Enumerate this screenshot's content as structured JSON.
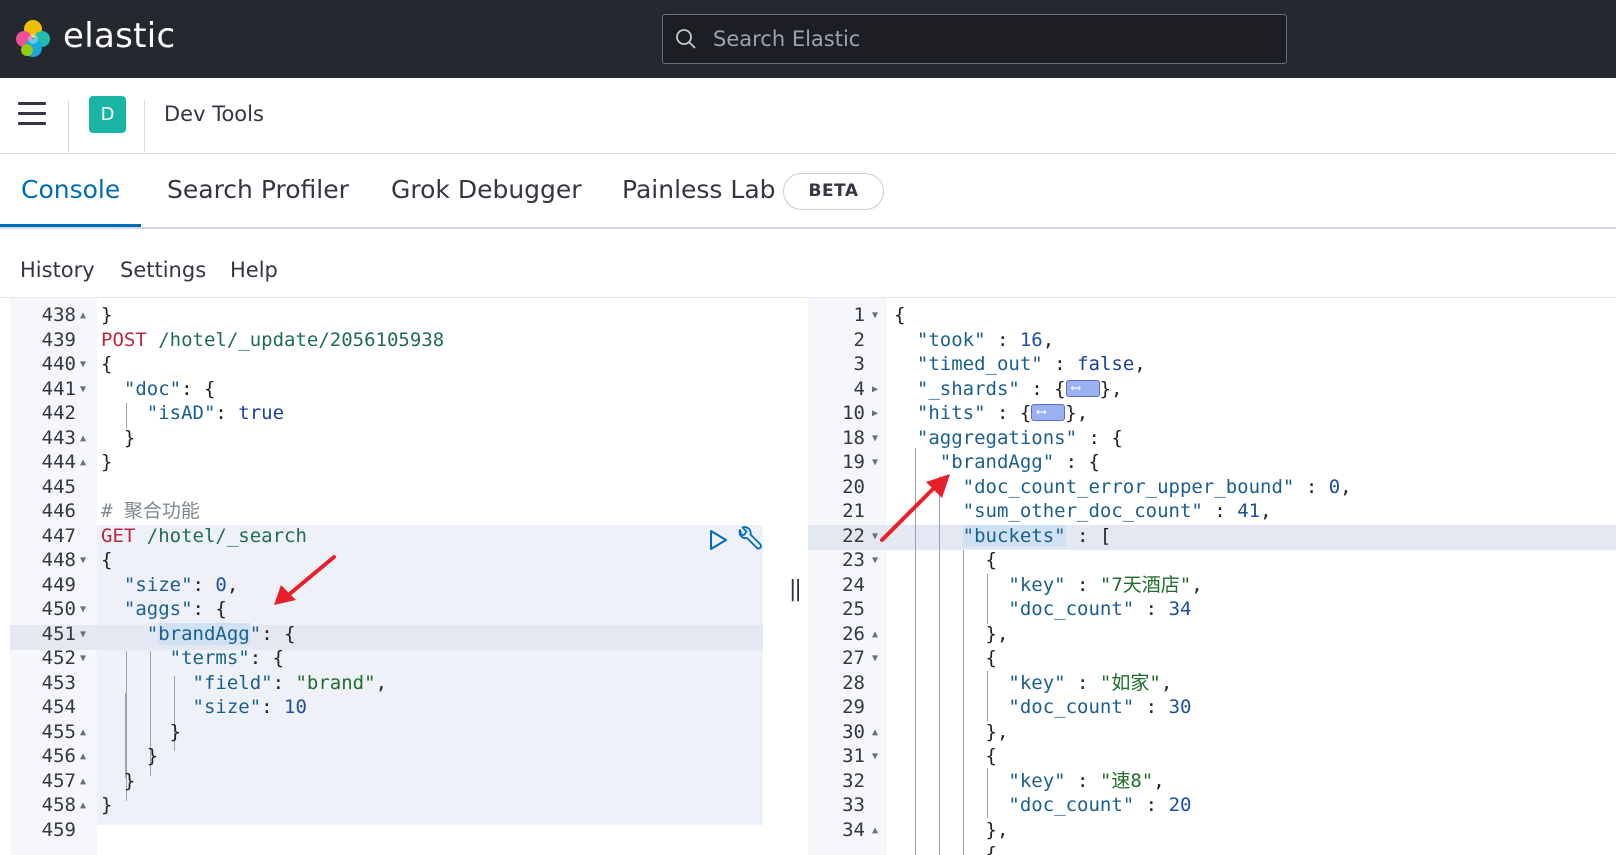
{
  "header": {
    "logo_text": "elastic",
    "search_placeholder": "Search Elastic"
  },
  "subheader": {
    "space_initial": "D",
    "app_title": "Dev Tools"
  },
  "tabs": [
    {
      "label": "Console",
      "active": true
    },
    {
      "label": "Search Profiler",
      "active": false
    },
    {
      "label": "Grok Debugger",
      "active": false
    },
    {
      "label": "Painless Lab",
      "active": false
    }
  ],
  "beta_badge": "BETA",
  "console_menu": [
    "History",
    "Settings",
    "Help"
  ],
  "request_editor": {
    "lines": [
      {
        "n": "438",
        "fold": "▲",
        "parts": [
          [
            "p",
            "}"
          ]
        ]
      },
      {
        "n": "439",
        "fold": "",
        "parts": [
          [
            "meth",
            "POST"
          ],
          [
            "p",
            " "
          ],
          [
            "url",
            "/hotel/_update/2056105938"
          ]
        ]
      },
      {
        "n": "440",
        "fold": "▼",
        "parts": [
          [
            "p",
            "{"
          ]
        ]
      },
      {
        "n": "441",
        "fold": "▼",
        "parts": [
          [
            "p",
            "  "
          ],
          [
            "key",
            "\"doc\""
          ],
          [
            "p",
            ": {"
          ]
        ]
      },
      {
        "n": "442",
        "fold": "",
        "parts": [
          [
            "p",
            "    "
          ],
          [
            "key",
            "\"isAD\""
          ],
          [
            "p",
            ": "
          ],
          [
            "bool",
            "true"
          ]
        ]
      },
      {
        "n": "443",
        "fold": "▲",
        "parts": [
          [
            "p",
            "  }"
          ]
        ]
      },
      {
        "n": "444",
        "fold": "▲",
        "parts": [
          [
            "p",
            "}"
          ]
        ]
      },
      {
        "n": "445",
        "fold": "",
        "parts": []
      },
      {
        "n": "446",
        "fold": "",
        "parts": [
          [
            "cmt",
            "# 聚合功能"
          ]
        ]
      },
      {
        "n": "447",
        "fold": "",
        "parts": [
          [
            "meth",
            "GET"
          ],
          [
            "p",
            " "
          ],
          [
            "url",
            "/hotel/_search"
          ]
        ]
      },
      {
        "n": "448",
        "fold": "▼",
        "parts": [
          [
            "p",
            "{"
          ]
        ]
      },
      {
        "n": "449",
        "fold": "",
        "parts": [
          [
            "p",
            "  "
          ],
          [
            "key",
            "\"size\""
          ],
          [
            "p",
            ": "
          ],
          [
            "num",
            "0"
          ],
          [
            "p",
            ","
          ]
        ]
      },
      {
        "n": "450",
        "fold": "▼",
        "parts": [
          [
            "p",
            "  "
          ],
          [
            "key",
            "\"aggs\""
          ],
          [
            "p",
            ": {"
          ]
        ]
      },
      {
        "n": "451",
        "fold": "▼",
        "parts": [
          [
            "p",
            "    "
          ],
          [
            "key",
            "\""
          ],
          [
            "sel",
            "brandAgg"
          ],
          [
            "key",
            "\""
          ],
          [
            "p",
            ": {"
          ]
        ]
      },
      {
        "n": "452",
        "fold": "▼",
        "parts": [
          [
            "p",
            "      "
          ],
          [
            "key",
            "\"terms\""
          ],
          [
            "p",
            ": {"
          ]
        ]
      },
      {
        "n": "453",
        "fold": "",
        "parts": [
          [
            "p",
            "        "
          ],
          [
            "key",
            "\"field\""
          ],
          [
            "p",
            ": "
          ],
          [
            "str",
            "\"brand\""
          ],
          [
            "p",
            ","
          ]
        ]
      },
      {
        "n": "454",
        "fold": "",
        "parts": [
          [
            "p",
            "        "
          ],
          [
            "key",
            "\"size\""
          ],
          [
            "p",
            ": "
          ],
          [
            "num",
            "10"
          ]
        ]
      },
      {
        "n": "455",
        "fold": "▲",
        "parts": [
          [
            "p",
            "      }"
          ]
        ]
      },
      {
        "n": "456",
        "fold": "▲",
        "parts": [
          [
            "p",
            "    }"
          ]
        ]
      },
      {
        "n": "457",
        "fold": "▲",
        "parts": [
          [
            "p",
            "  }"
          ]
        ]
      },
      {
        "n": "458",
        "fold": "▲",
        "parts": [
          [
            "p",
            "}"
          ]
        ]
      },
      {
        "n": "459",
        "fold": "",
        "parts": []
      }
    ]
  },
  "response_editor": {
    "lines": [
      {
        "n": "1",
        "fold": "▼",
        "parts": [
          [
            "p",
            "{"
          ]
        ]
      },
      {
        "n": "2",
        "fold": "",
        "parts": [
          [
            "p",
            "  "
          ],
          [
            "key",
            "\"took\""
          ],
          [
            "p",
            " : "
          ],
          [
            "num",
            "16"
          ],
          [
            "p",
            ","
          ]
        ]
      },
      {
        "n": "3",
        "fold": "",
        "parts": [
          [
            "p",
            "  "
          ],
          [
            "key",
            "\"timed_out\""
          ],
          [
            "p",
            " : "
          ],
          [
            "bool",
            "false"
          ],
          [
            "p",
            ","
          ]
        ]
      },
      {
        "n": "4",
        "fold": "▶",
        "parts": [
          [
            "p",
            "  "
          ],
          [
            "key",
            "\"_shards\""
          ],
          [
            "p",
            " : {"
          ],
          [
            "widget",
            ""
          ],
          [
            "p",
            "},"
          ]
        ]
      },
      {
        "n": "10",
        "fold": "▶",
        "parts": [
          [
            "p",
            "  "
          ],
          [
            "key",
            "\"hits\""
          ],
          [
            "p",
            " : {"
          ],
          [
            "widget",
            ""
          ],
          [
            "p",
            "},"
          ]
        ]
      },
      {
        "n": "18",
        "fold": "▼",
        "parts": [
          [
            "p",
            "  "
          ],
          [
            "key",
            "\"aggregations\""
          ],
          [
            "p",
            " : {"
          ]
        ]
      },
      {
        "n": "19",
        "fold": "▼",
        "parts": [
          [
            "p",
            "    "
          ],
          [
            "key",
            "\"brandAgg\""
          ],
          [
            "p",
            " : {"
          ]
        ]
      },
      {
        "n": "20",
        "fold": "",
        "parts": [
          [
            "p",
            "      "
          ],
          [
            "key",
            "\"doc_count_error_upper_bound\""
          ],
          [
            "p",
            " : "
          ],
          [
            "num",
            "0"
          ],
          [
            "p",
            ","
          ]
        ]
      },
      {
        "n": "21",
        "fold": "",
        "parts": [
          [
            "p",
            "      "
          ],
          [
            "key",
            "\"sum_other_doc_count\""
          ],
          [
            "p",
            " : "
          ],
          [
            "num",
            "41"
          ],
          [
            "p",
            ","
          ]
        ]
      },
      {
        "n": "22",
        "fold": "▼",
        "parts": [
          [
            "p",
            "      "
          ],
          [
            "sel",
            "\"buckets\""
          ],
          [
            "p",
            " : ["
          ]
        ]
      },
      {
        "n": "23",
        "fold": "▼",
        "parts": [
          [
            "p",
            "        {"
          ]
        ]
      },
      {
        "n": "24",
        "fold": "",
        "parts": [
          [
            "p",
            "          "
          ],
          [
            "key",
            "\"key\""
          ],
          [
            "p",
            " : "
          ],
          [
            "str",
            "\"7天酒店\""
          ],
          [
            "p",
            ","
          ]
        ]
      },
      {
        "n": "25",
        "fold": "",
        "parts": [
          [
            "p",
            "          "
          ],
          [
            "key",
            "\"doc_count\""
          ],
          [
            "p",
            " : "
          ],
          [
            "num",
            "34"
          ]
        ]
      },
      {
        "n": "26",
        "fold": "▲",
        "parts": [
          [
            "p",
            "        },"
          ]
        ]
      },
      {
        "n": "27",
        "fold": "▼",
        "parts": [
          [
            "p",
            "        {"
          ]
        ]
      },
      {
        "n": "28",
        "fold": "",
        "parts": [
          [
            "p",
            "          "
          ],
          [
            "key",
            "\"key\""
          ],
          [
            "p",
            " : "
          ],
          [
            "str",
            "\"如家\""
          ],
          [
            "p",
            ","
          ]
        ]
      },
      {
        "n": "29",
        "fold": "",
        "parts": [
          [
            "p",
            "          "
          ],
          [
            "key",
            "\"doc_count\""
          ],
          [
            "p",
            " : "
          ],
          [
            "num",
            "30"
          ]
        ]
      },
      {
        "n": "30",
        "fold": "▲",
        "parts": [
          [
            "p",
            "        },"
          ]
        ]
      },
      {
        "n": "31",
        "fold": "▼",
        "parts": [
          [
            "p",
            "        {"
          ]
        ]
      },
      {
        "n": "32",
        "fold": "",
        "parts": [
          [
            "p",
            "          "
          ],
          [
            "key",
            "\"key\""
          ],
          [
            "p",
            " : "
          ],
          [
            "str",
            "\"速8\""
          ],
          [
            "p",
            ","
          ]
        ]
      },
      {
        "n": "33",
        "fold": "",
        "parts": [
          [
            "p",
            "          "
          ],
          [
            "key",
            "\"doc_count\""
          ],
          [
            "p",
            " : "
          ],
          [
            "num",
            "20"
          ]
        ]
      },
      {
        "n": "34",
        "fold": "▲",
        "parts": [
          [
            "p",
            "        },"
          ]
        ]
      },
      {
        "n": "",
        "fold": "",
        "parts": [
          [
            "p",
            "        {"
          ]
        ]
      }
    ]
  },
  "colors": {
    "header_bg": "#25282f",
    "accent": "#006bb8",
    "space_avatar": "#1ab5a5",
    "annotation_arrow": "#e8202a"
  }
}
